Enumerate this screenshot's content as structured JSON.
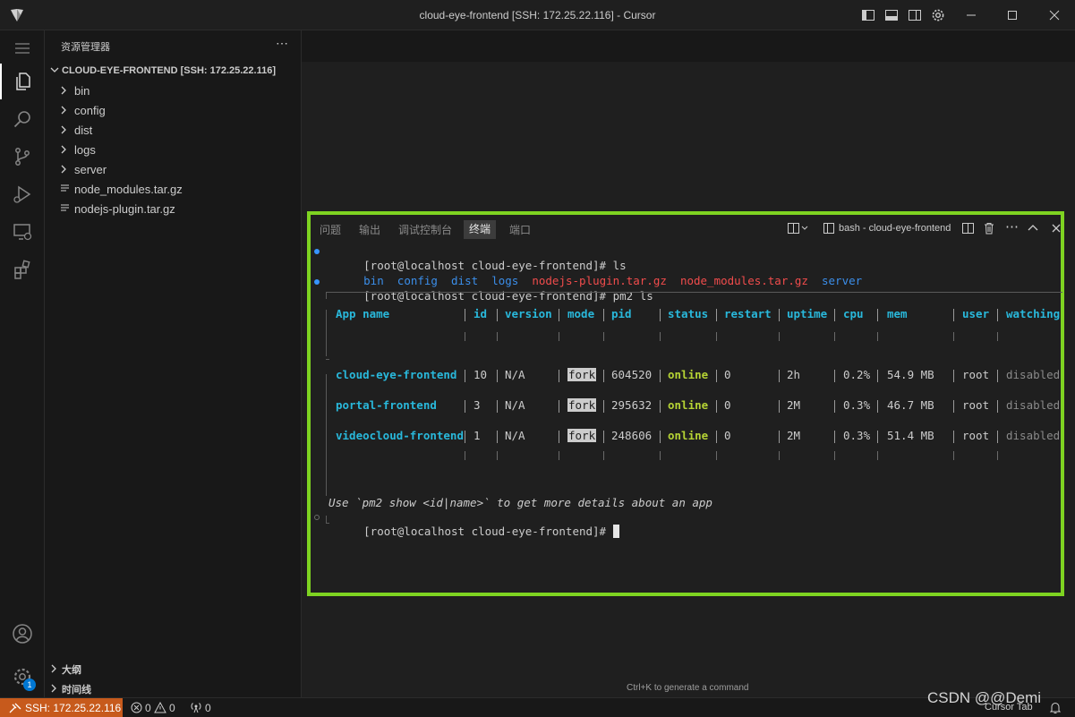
{
  "window": {
    "title": "cloud-eye-frontend [SSH: 172.25.22.116] - Cursor"
  },
  "sidebar": {
    "title": "资源管理器",
    "root": "CLOUD-EYE-FRONTEND [SSH: 172.25.22.116]",
    "folders": [
      "bin",
      "config",
      "dist",
      "logs",
      "server"
    ],
    "files": [
      "node_modules.tar.gz",
      "nodejs-plugin.tar.gz"
    ],
    "outline_label": "大纲",
    "timeline_label": "时间线"
  },
  "activity": {
    "settings_badge": "1"
  },
  "panel": {
    "tabs": [
      "问题",
      "输出",
      "调试控制台",
      "终端",
      "端口"
    ],
    "active_tab": "终端",
    "terminal_name": "bash - cloud-eye-frontend"
  },
  "terminal": {
    "prompt": "[root@localhost cloud-eye-frontend]#",
    "cmd1": "ls",
    "ls_output": [
      {
        "text": "bin",
        "kind": "dir"
      },
      {
        "text": "config",
        "kind": "dir"
      },
      {
        "text": "dist",
        "kind": "dir"
      },
      {
        "text": "logs",
        "kind": "dir"
      },
      {
        "text": "nodejs-plugin.tar.gz",
        "kind": "gz"
      },
      {
        "text": "node_modules.tar.gz",
        "kind": "gz"
      },
      {
        "text": "server",
        "kind": "dir"
      }
    ],
    "cmd2": "pm2 ls",
    "pm2_headers": [
      "App name",
      "id",
      "version",
      "mode",
      "pid",
      "status",
      "restart",
      "uptime",
      "cpu",
      "mem",
      "user",
      "watching"
    ],
    "pm2_rows": [
      [
        "cloud-eye-frontend",
        "10",
        "N/A",
        "fork",
        "604520",
        "online",
        "0",
        "2h",
        "0.2%",
        "54.9 MB",
        "root",
        "disabled"
      ],
      [
        "portal-frontend",
        "3",
        "N/A",
        "fork",
        "295632",
        "online",
        "0",
        "2M",
        "0.3%",
        "46.7 MB",
        "root",
        "disabled"
      ],
      [
        "videocloud-frontend",
        "1",
        "N/A",
        "fork",
        "248606",
        "online",
        "0",
        "2M",
        "0.3%",
        "51.4 MB",
        "root",
        "disabled"
      ]
    ],
    "hint": "Use `pm2 show <id|name>` to get more details about an app"
  },
  "editor": {
    "hint": "Ctrl+K to generate a command"
  },
  "statusbar": {
    "remote": "SSH: 172.25.22.116",
    "errors": "0",
    "warnings": "0",
    "ports": "0",
    "cursor_tab": "Cursor Tab"
  },
  "watermark": "CSDN @@Demi",
  "colors": {
    "highlight_border": "#7ed321",
    "remote_bg": "#c75a1c",
    "dir_color": "#3b8eea",
    "archive_color": "#f14c4c",
    "online_color": "#b5d334",
    "header_color": "#29b8db"
  }
}
